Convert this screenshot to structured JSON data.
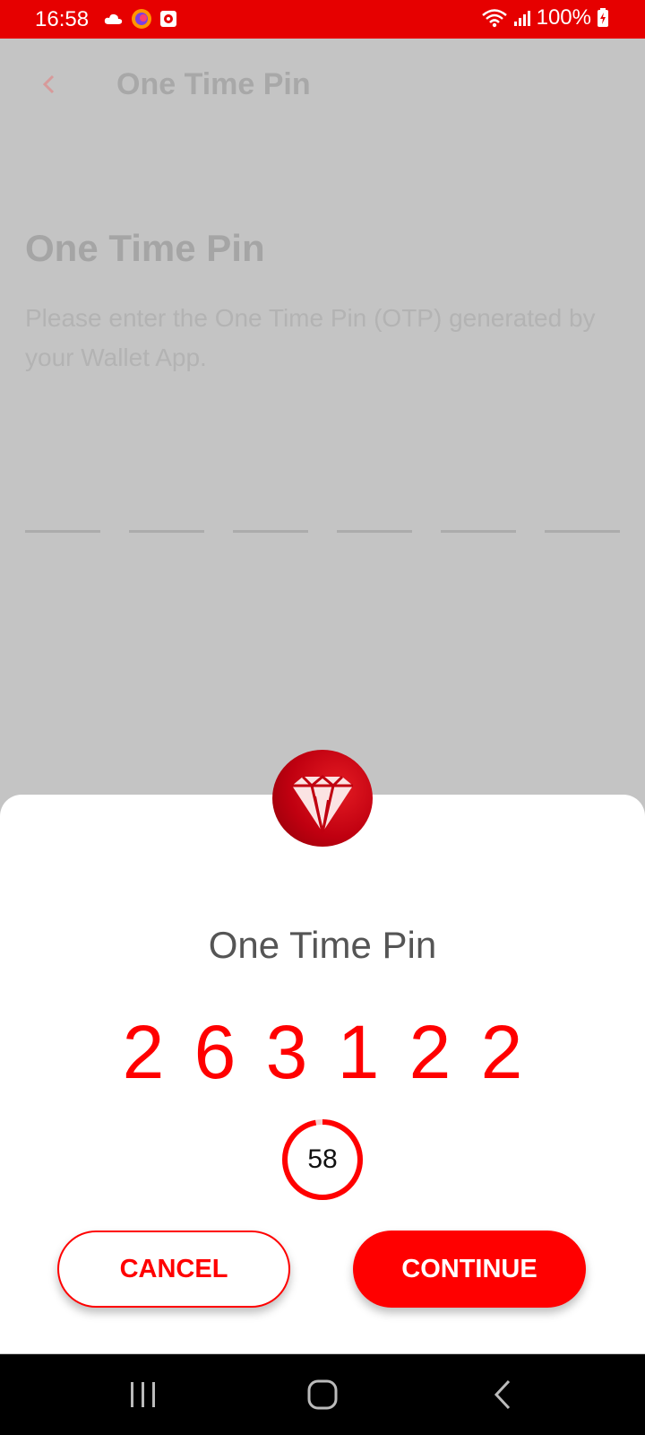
{
  "status_bar": {
    "time": "16:58",
    "battery": "100%",
    "icons_left": [
      "cloud-icon",
      "browser-icon",
      "app-notification-icon"
    ],
    "icons_right": [
      "wifi-icon",
      "signal-icon",
      "battery-charging-icon"
    ]
  },
  "background_screen": {
    "app_bar_title": "One Time Pin",
    "heading": "One Time Pin",
    "description": "Please enter the One Time Pin (OTP) generated by your Wallet App.",
    "otp_field_count": 6
  },
  "modal": {
    "title": "One Time Pin",
    "pin_digits": [
      "2",
      "6",
      "3",
      "1",
      "2",
      "2"
    ],
    "timer_seconds": "58",
    "timer_progress": 0.97,
    "cancel_label": "CANCEL",
    "continue_label": "CONTINUE",
    "accent_color": "#ff0000"
  },
  "nav_bar": {
    "buttons": [
      "recent-apps-icon",
      "home-icon",
      "back-icon"
    ]
  }
}
